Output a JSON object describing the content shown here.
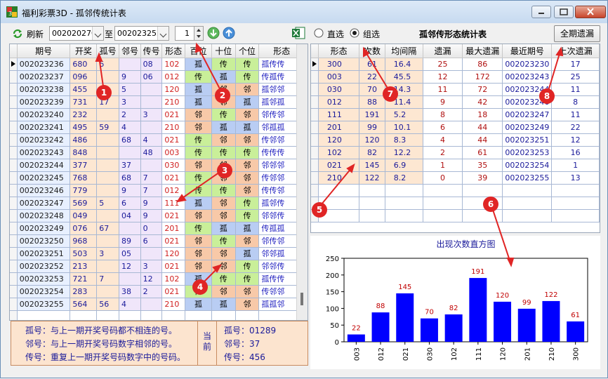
{
  "window": {
    "title": "福利彩票3D - 孤邻传统计表"
  },
  "toolbar": {
    "refresh_label": "刷新",
    "from_value": "002020270",
    "to_label": "至",
    "to_value": "002023255",
    "spin_value": "1"
  },
  "radios": {
    "direct_label": "直选",
    "group_label": "组选",
    "group_selected": true
  },
  "right_title": "孤邻传形态统计表",
  "all_missing_button": "全期遗漏",
  "left_table": {
    "headers": [
      "期号",
      "开奖",
      "孤号",
      "邻号",
      "传号",
      "形态",
      "百位",
      "十位",
      "个位",
      "形态"
    ],
    "rows": [
      [
        "002023236",
        "680",
        "6",
        "",
        "08",
        "102",
        "孤",
        "传",
        "传",
        "孤传传"
      ],
      [
        "002023237",
        "096",
        "",
        "9",
        "06",
        "012",
        "传",
        "孤",
        "传",
        "传孤传"
      ],
      [
        "002023238",
        "455",
        "4",
        "5",
        "",
        "120",
        "孤",
        "邻",
        "邻",
        "孤邻邻"
      ],
      [
        "002023239",
        "731",
        "17",
        "3",
        "",
        "210",
        "孤",
        "邻",
        "孤",
        "孤邻孤"
      ],
      [
        "002023240",
        "232",
        "",
        "2",
        "3",
        "021",
        "邻",
        "传",
        "邻",
        "邻传邻"
      ],
      [
        "002023241",
        "495",
        "59",
        "4",
        "",
        "210",
        "邻",
        "孤",
        "孤",
        "邻孤孤"
      ],
      [
        "002023242",
        "486",
        "",
        "68",
        "4",
        "021",
        "传",
        "邻",
        "邻",
        "传邻邻"
      ],
      [
        "002023243",
        "848",
        "",
        "",
        "48",
        "003",
        "传",
        "传",
        "传",
        "传传传"
      ],
      [
        "002023244",
        "377",
        "",
        "37",
        "",
        "030",
        "邻",
        "邻",
        "邻",
        "邻邻邻"
      ],
      [
        "002023245",
        "768",
        "",
        "68",
        "7",
        "021",
        "传",
        "邻",
        "邻",
        "传邻邻"
      ],
      [
        "002023246",
        "779",
        "",
        "9",
        "7",
        "012",
        "传",
        "传",
        "邻",
        "传传邻"
      ],
      [
        "002023247",
        "569",
        "5",
        "6",
        "9",
        "111",
        "孤",
        "邻",
        "传",
        "孤邻传"
      ],
      [
        "002023248",
        "049",
        "",
        "04",
        "9",
        "021",
        "邻",
        "邻",
        "传",
        "邻邻传"
      ],
      [
        "002023249",
        "076",
        "67",
        "",
        "0",
        "201",
        "传",
        "孤",
        "孤",
        "传孤孤"
      ],
      [
        "002023250",
        "968",
        "",
        "89",
        "6",
        "021",
        "邻",
        "传",
        "邻",
        "邻传邻"
      ],
      [
        "002023251",
        "503",
        "3",
        "05",
        "",
        "120",
        "邻",
        "邻",
        "孤",
        "邻邻孤"
      ],
      [
        "002023252",
        "213",
        "",
        "12",
        "3",
        "021",
        "邻",
        "邻",
        "传",
        "邻邻传"
      ],
      [
        "002023253",
        "721",
        "7",
        "",
        "12",
        "102",
        "孤",
        "传",
        "传",
        "孤传传"
      ],
      [
        "002023254",
        "283",
        "",
        "38",
        "2",
        "021",
        "传",
        "邻",
        "邻",
        "传邻邻"
      ],
      [
        "002023255",
        "564",
        "56",
        "4",
        "",
        "210",
        "孤",
        "孤",
        "邻",
        "孤孤邻"
      ]
    ]
  },
  "right_table": {
    "headers": [
      "形态",
      "次数",
      "均间隔",
      "遗漏",
      "最大遗漏",
      "最近期号",
      "上次遗漏"
    ],
    "rows": [
      [
        "300",
        "61",
        "16.4",
        "25",
        "86",
        "002023230",
        "17"
      ],
      [
        "003",
        "22",
        "45.5",
        "12",
        "172",
        "002023243",
        "25"
      ],
      [
        "030",
        "70",
        "14.3",
        "11",
        "72",
        "002023244",
        "11"
      ],
      [
        "012",
        "88",
        "11.4",
        "9",
        "42",
        "002023246",
        "8"
      ],
      [
        "111",
        "191",
        "5.2",
        "8",
        "18",
        "002023247",
        "11"
      ],
      [
        "201",
        "99",
        "10.1",
        "6",
        "44",
        "002023249",
        "22"
      ],
      [
        "120",
        "120",
        "8.3",
        "4",
        "44",
        "002023251",
        "12"
      ],
      [
        "102",
        "82",
        "12.2",
        "2",
        "61",
        "002023253",
        "16"
      ],
      [
        "021",
        "145",
        "6.9",
        "1",
        "35",
        "002023254",
        "1"
      ],
      [
        "210",
        "122",
        "8.2",
        "0",
        "39",
        "002023255",
        "13"
      ]
    ]
  },
  "info": {
    "lines": [
      "孤号：与上一期开奖号码都不相连的号。",
      "邻号：与上一期开奖号码数字相邻的号。",
      "传号：重复上一期开奖号码数字中的号码。"
    ],
    "current_label": "当前",
    "values": [
      "孤号：01289",
      "邻号：37",
      "传号：456"
    ]
  },
  "chart_data": {
    "type": "bar",
    "title": "出现次数直方图",
    "categories": [
      "003",
      "012",
      "021",
      "030",
      "102",
      "111",
      "120",
      "201",
      "210",
      "300"
    ],
    "values": [
      22,
      88,
      145,
      70,
      82,
      191,
      120,
      99,
      122,
      61
    ],
    "ylim": [
      0,
      250
    ],
    "yticks": [
      0,
      50,
      100,
      150,
      200,
      250
    ],
    "color": "#0000ff",
    "label_color": "#c00000",
    "grid": false
  },
  "markers": [
    "1",
    "2",
    "3",
    "4",
    "5",
    "6",
    "7",
    "8"
  ],
  "colors": {
    "marker": "#e02525",
    "gu_bg": "#b9cdf3",
    "lin_bg": "#f8c9a8",
    "chuan_bg": "#c9ef99"
  }
}
